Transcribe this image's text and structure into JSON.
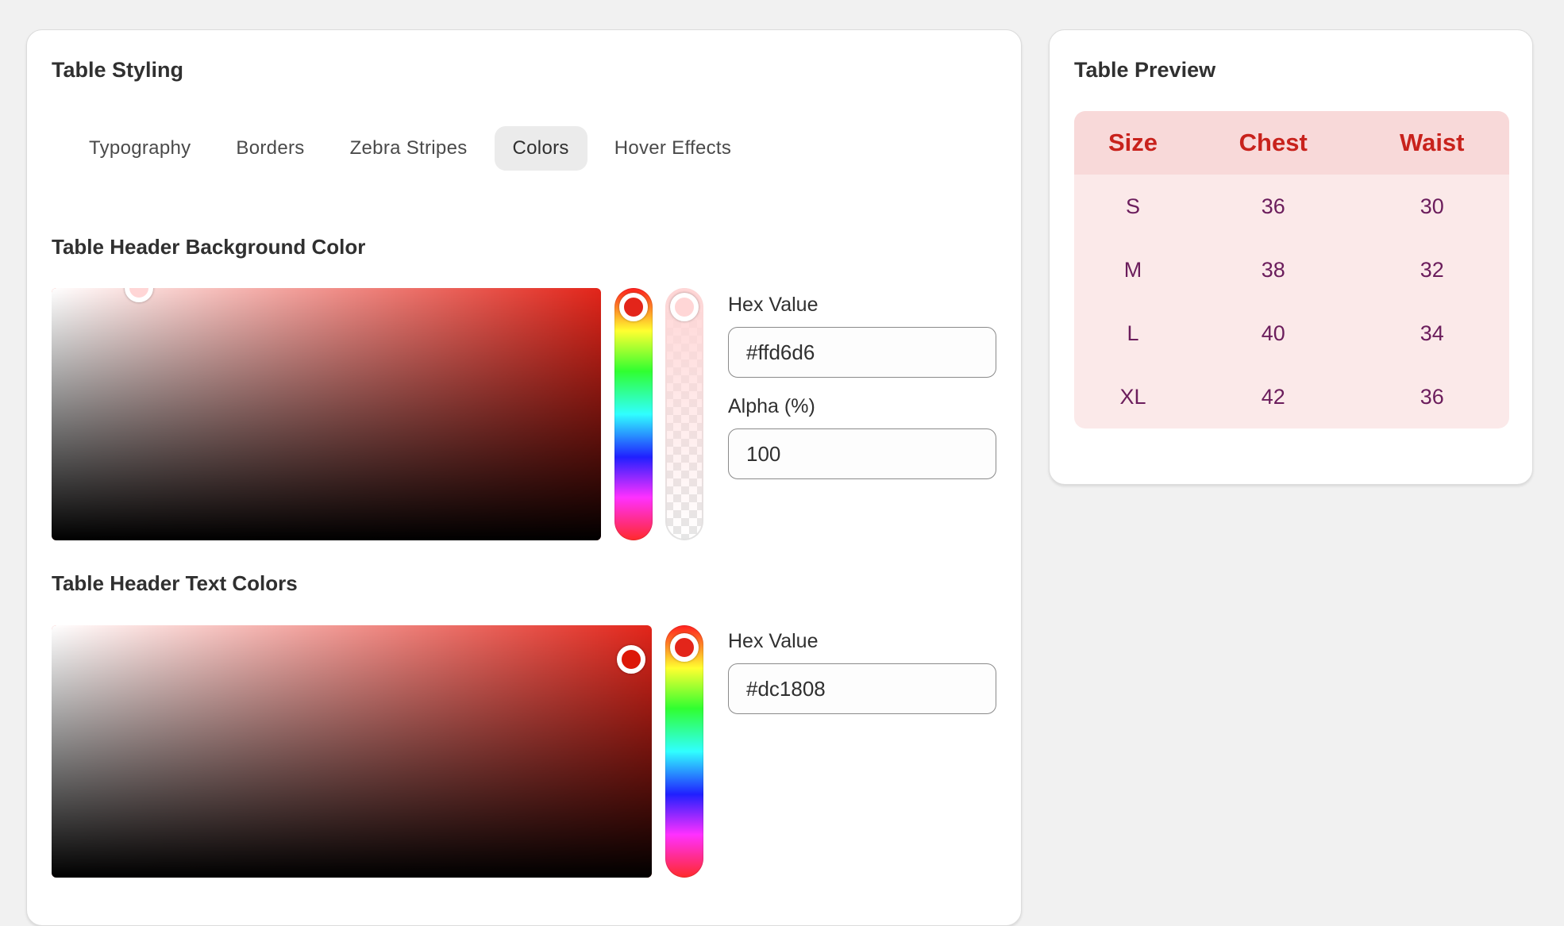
{
  "styling_panel": {
    "title": "Table Styling",
    "tabs": [
      {
        "label": "Typography",
        "active": false
      },
      {
        "label": "Borders",
        "active": false
      },
      {
        "label": "Zebra Stripes",
        "active": false
      },
      {
        "label": "Colors",
        "active": true
      },
      {
        "label": "Hover Effects",
        "active": false
      }
    ],
    "header_background": {
      "title": "Table Header Background Color",
      "hue_color": "#e3251a",
      "hex_label": "Hex Value",
      "hex_value": "#ffd6d6",
      "alpha_label": "Alpha (%)",
      "alpha_value": "100",
      "alpha_color": "#ffd6d6"
    },
    "header_text": {
      "title": "Table Header Text Colors",
      "hue_color": "#e3251a",
      "hex_label": "Hex Value",
      "hex_value": "#dc1808"
    }
  },
  "preview_panel": {
    "title": "Table Preview",
    "header_bg": "#f8d9d9",
    "header_text_color": "#c8221c",
    "body_bg": "#fbe9e9",
    "body_text_color": "#6b1d5c",
    "columns": [
      "Size",
      "Chest",
      "Waist"
    ],
    "rows": [
      [
        "S",
        "36",
        "30"
      ],
      [
        "M",
        "38",
        "32"
      ],
      [
        "L",
        "40",
        "34"
      ],
      [
        "XL",
        "42",
        "36"
      ]
    ]
  }
}
